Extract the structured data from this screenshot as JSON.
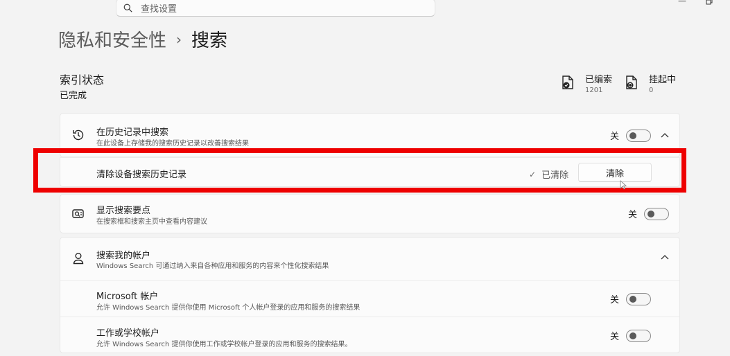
{
  "search": {
    "placeholder": "查找设置"
  },
  "breadcrumb": {
    "parent": "隐私和安全性",
    "separator": "›",
    "current": "搜索"
  },
  "indexing": {
    "title": "索引状态",
    "status": "已完成",
    "indexed": {
      "label": "已编索",
      "count": "1201"
    },
    "pending": {
      "label": "挂起中",
      "count": "0"
    }
  },
  "history": {
    "title": "在历史记录中搜索",
    "description": "在此设备上存储我的搜索历史记录以改善搜索结果",
    "toggle_label": "关",
    "clear": {
      "title": "清除设备搜索历史记录",
      "status": "已清除",
      "button": "清除"
    }
  },
  "highlights": {
    "title": "显示搜索要点",
    "description": "在搜索框和搜索主页中查看内容建议",
    "toggle_label": "关"
  },
  "accounts": {
    "title": "搜索我的帐户",
    "description": "Windows Search 可通过纳入来自各种应用和服务的内容来个性化搜索结果",
    "microsoft": {
      "title": "Microsoft 帐户",
      "description": "允许 Windows Search 提供你使用 Microsoft 个人帐户登录的应用和服务的搜索结果",
      "toggle_label": "关"
    },
    "work": {
      "title": "工作或学校帐户",
      "description": "允许 Windows Search 提供你使用工作或学校帐户登录的应用和服务的搜索结果。",
      "toggle_label": "关"
    }
  },
  "colors": {
    "highlight": "#ee0000",
    "background": "#f3f3f3",
    "card": "#fbfbfb"
  }
}
